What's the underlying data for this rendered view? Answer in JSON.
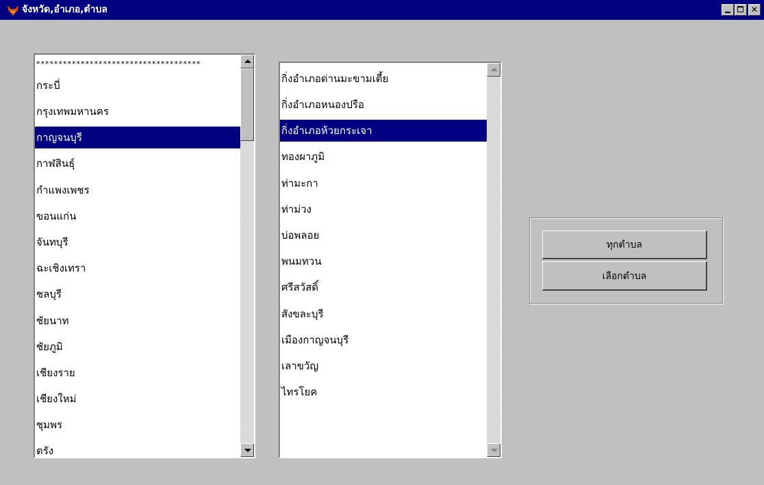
{
  "window": {
    "title": "จังหวัด,อำเภอ,ตำบล",
    "icon": "fox-app-icon",
    "controls": [
      "minimize-icon",
      "maximize-icon",
      "close-icon"
    ],
    "title_bar_color": "#000080"
  },
  "provinces": {
    "items": [
      "*************************************",
      "กระบี่",
      "กรุงเทพมหานคร",
      "กาญจนบุรี",
      "กาฬสินธุ์",
      "กำแพงเพชร",
      "ขอนแก่น",
      "จันทบุรี",
      "ฉะเชิงเทรา",
      "ชลบุรี",
      "ชัยนาท",
      "ชัยภูมิ",
      "เชียงราย",
      "เชียงใหม่",
      "ชุมพร",
      "ตรัง"
    ],
    "selected": "กาญจนบุรี"
  },
  "districts": {
    "items": [
      "กิ่งอำเภอด่านมะขามเตี้ย",
      "กิ่งอำเภอหนองปรือ",
      "กิ่งอำเภอห้วยกระเจา",
      "ทองผาภูมิ",
      "ท่ามะกา",
      "ท่าม่วง",
      "บ่อพลอย",
      "พนมทวน",
      "ศรีสวัสดิ์",
      "สังขละบุรี",
      "เมืองกาญจนบุรี",
      "เลาขวัญ",
      "ไทรโยค"
    ],
    "selected": "กิ่งอำเภอห้วยกระเจา"
  },
  "buttons": {
    "all_subdistricts": "ทุกตำบล",
    "select_subdistrict": "เลือกตำบล"
  },
  "colors": {
    "selection": "#000080",
    "face": "#c0c0c0"
  }
}
